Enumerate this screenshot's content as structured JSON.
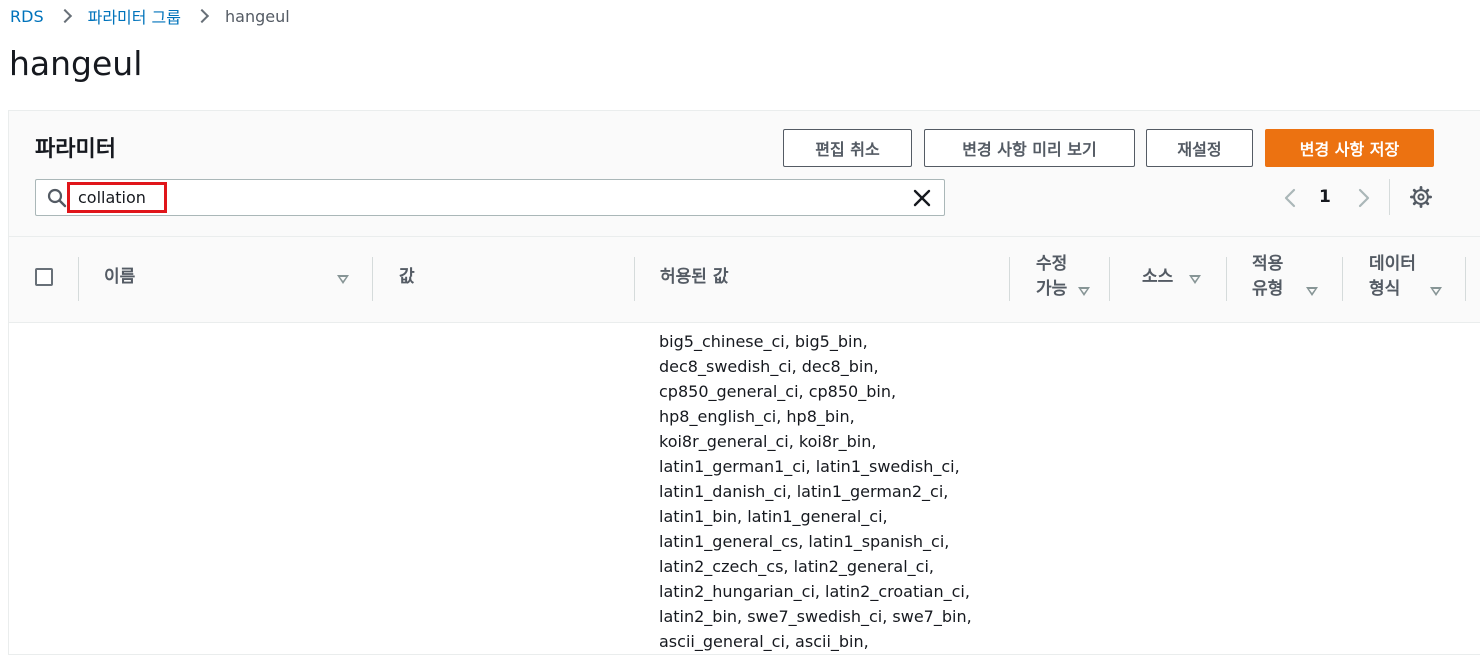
{
  "breadcrumb": {
    "items": [
      "RDS",
      "파라미터 그룹"
    ],
    "current": "hangeul"
  },
  "page": {
    "title": "hangeul"
  },
  "panel": {
    "title": "파라미터",
    "buttons": {
      "cancel_edit": "편집 취소",
      "preview_changes": "변경 사항 미리 보기",
      "reset": "재설정",
      "save_changes": "변경 사항 저장"
    },
    "search": {
      "value": "collation",
      "placeholder": ""
    },
    "pagination": {
      "current_page": "1"
    }
  },
  "table": {
    "columns": {
      "name": "이름",
      "value": "값",
      "allowed_values": "허용된 값",
      "modifiable_l1": "수정",
      "modifiable_l2": "가능",
      "source": "소스",
      "apply_type_l1": "적용",
      "apply_type_l2": "유형",
      "data_type_l1": "데이터",
      "data_type_l2": "형식"
    },
    "rows": [
      {
        "allowed_values_lines": [
          "big5_chinese_ci, big5_bin,",
          "dec8_swedish_ci, dec8_bin,",
          "cp850_general_ci, cp850_bin,",
          "hp8_english_ci, hp8_bin,",
          "koi8r_general_ci, koi8r_bin,",
          "latin1_german1_ci, latin1_swedish_ci,",
          "latin1_danish_ci, latin1_german2_ci,",
          "latin1_bin, latin1_general_ci,",
          "latin1_general_cs, latin1_spanish_ci,",
          "latin2_czech_cs, latin2_general_ci,",
          "latin2_hungarian_ci, latin2_croatian_ci,",
          "latin2_bin, swe7_swedish_ci, swe7_bin,",
          "ascii_general_ci, ascii_bin,"
        ]
      }
    ]
  },
  "colors": {
    "primary_button": "#ec7211",
    "link": "#0073bb",
    "highlight_box": "#e0151a"
  },
  "icons": [
    "chevron-right-icon",
    "search-icon",
    "close-icon",
    "chevron-left-icon",
    "gear-icon",
    "sort-down-icon"
  ]
}
